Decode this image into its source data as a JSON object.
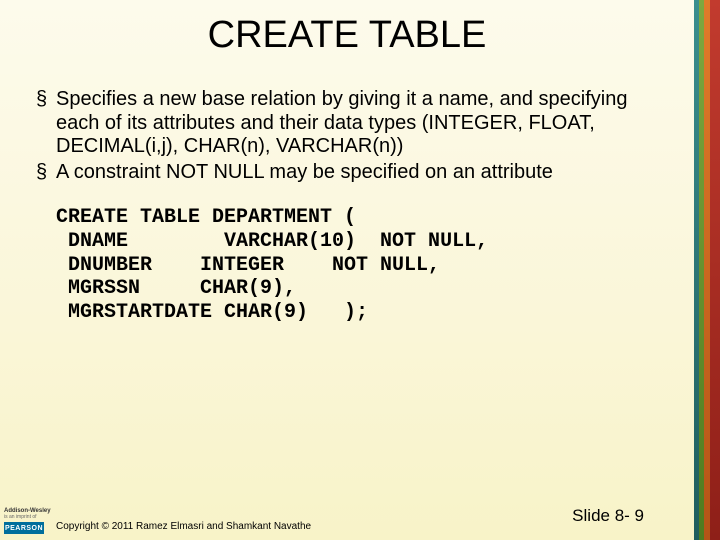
{
  "title": "CREATE TABLE",
  "bullets": [
    "Specifies a new base relation by giving it a name, and specifying each of its attributes and their data types (INTEGER, FLOAT, DECIMAL(i,j), CHAR(n), VARCHAR(n))",
    "A constraint NOT NULL may be specified on an attribute"
  ],
  "code": "CREATE TABLE DEPARTMENT (\n DNAME        VARCHAR(10)  NOT NULL,\n DNUMBER    INTEGER    NOT NULL,\n MGRSSN     CHAR(9),\n MGRSTARTDATE CHAR(9)   );",
  "publisher": {
    "line1": "Addison-Wesley",
    "line2": "is an imprint of",
    "brand": "PEARSON"
  },
  "copyright": "Copyright © 2011 Ramez Elmasri and Shamkant Navathe",
  "slide_label": "Slide 8- 9"
}
